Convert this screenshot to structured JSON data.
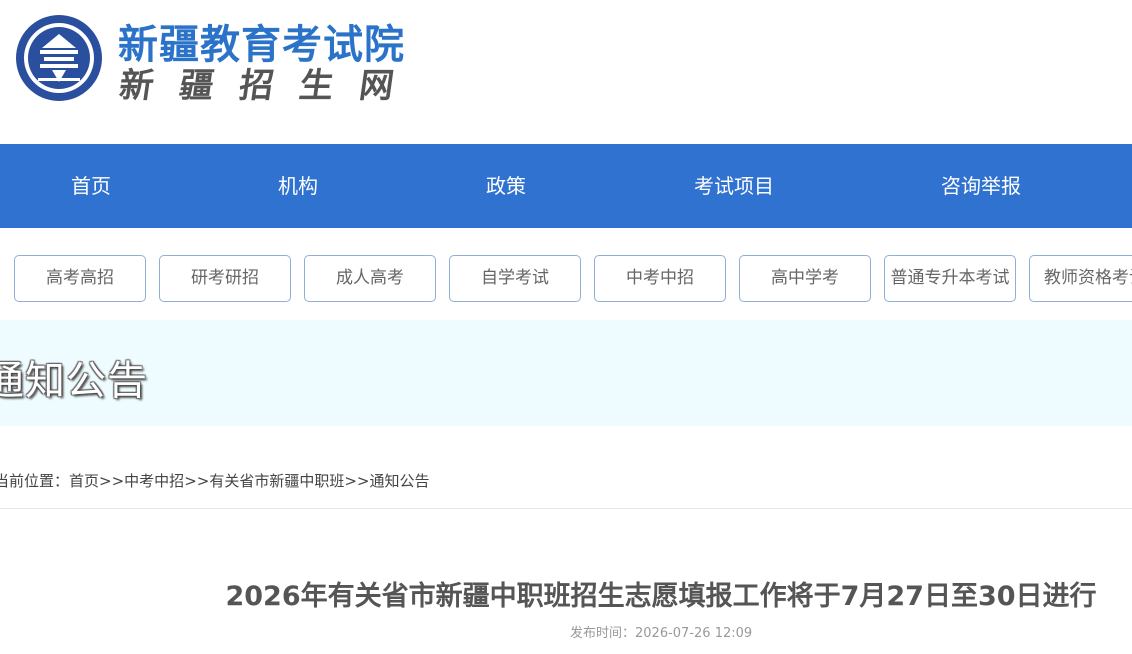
{
  "header": {
    "logo_icon": "institute-emblem-icon",
    "title": "新疆教育考试院",
    "subtitle": "新疆招生网"
  },
  "main_nav": {
    "items": [
      {
        "label": "首页"
      },
      {
        "label": "机构"
      },
      {
        "label": "政策"
      },
      {
        "label": "考试项目"
      },
      {
        "label": "咨询举报"
      }
    ]
  },
  "sub_nav": {
    "items": [
      {
        "label": "高考高招"
      },
      {
        "label": "研考研招"
      },
      {
        "label": "成人高考"
      },
      {
        "label": "自学考试"
      },
      {
        "label": "中考中招"
      },
      {
        "label": "高中学考"
      },
      {
        "label": "普通专升本考试"
      },
      {
        "label": "教师资格考试"
      }
    ]
  },
  "banner": {
    "title": "通知公告"
  },
  "breadcrumb": {
    "prefix": "当前位置：",
    "items": [
      {
        "label": "首页"
      },
      {
        "label": "中考中招"
      },
      {
        "label": "有关省市新疆中职班"
      },
      {
        "label": "通知公告"
      }
    ],
    "separator": ">>"
  },
  "article": {
    "title": "2026年有关省市新疆中职班招生志愿填报工作将于7月27日至30日进行",
    "publish_label": "发布时间：",
    "publish_time": "2026-07-26 12:09"
  },
  "colors": {
    "brand_blue": "#3072cf",
    "logo_title": "#2a73c9",
    "banner_bg": "#eefcff",
    "button_border": "#8fb0d6"
  }
}
